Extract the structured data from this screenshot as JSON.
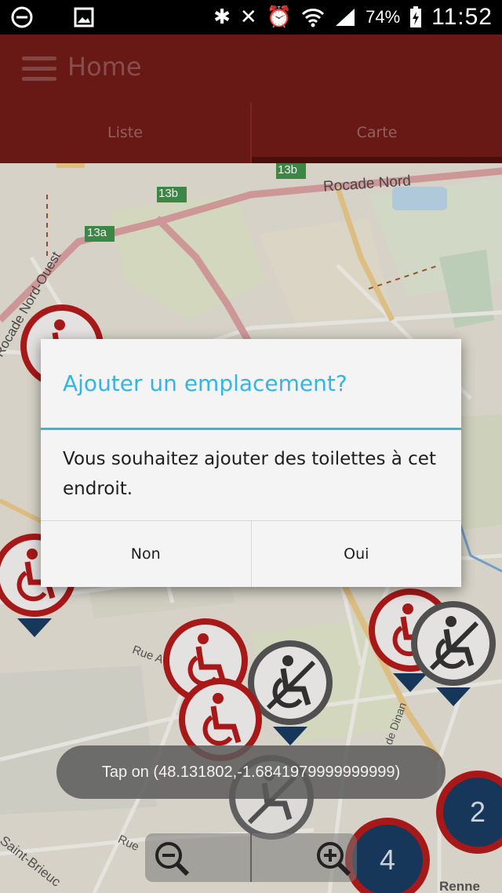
{
  "status_bar": {
    "icons": [
      "do-not-disturb-icon",
      "image-icon",
      "bluetooth-icon",
      "mute-icon",
      "alarm-icon",
      "wifi-icon",
      "signal-icon",
      "battery-charging-icon"
    ],
    "battery": "74%",
    "time": "11:52"
  },
  "app_bar": {
    "title": "Home",
    "menu_icon": "menu-icon"
  },
  "tabs": [
    {
      "label": "Liste",
      "active": false
    },
    {
      "label": "Carte",
      "active": true
    }
  ],
  "map": {
    "road_labels": [
      "Rocade Nord",
      "Rocade Nord-Ouest",
      "Rue A",
      "Saint-Brieuc",
      "Rue",
      "de Dinan",
      "Renne"
    ],
    "route_shields": [
      "13b",
      "13b",
      "13a"
    ],
    "clusters": [
      "2",
      "4"
    ],
    "colors": {
      "marker_red": "#b01a1a",
      "marker_gray": "#555555",
      "marker_pin": "#183a5e"
    }
  },
  "dialog": {
    "title": "Ajouter un emplacement?",
    "message": "Vous souhaitez ajouter des toilettes à cet endroit.",
    "negative": "Non",
    "positive": "Oui",
    "accent": "#33b5e5"
  },
  "toast": {
    "text": "Tap on (48.131802,-1.6841979999999999)"
  },
  "zoom": {
    "out_icon": "zoom-out-icon",
    "in_icon": "zoom-in-icon"
  }
}
